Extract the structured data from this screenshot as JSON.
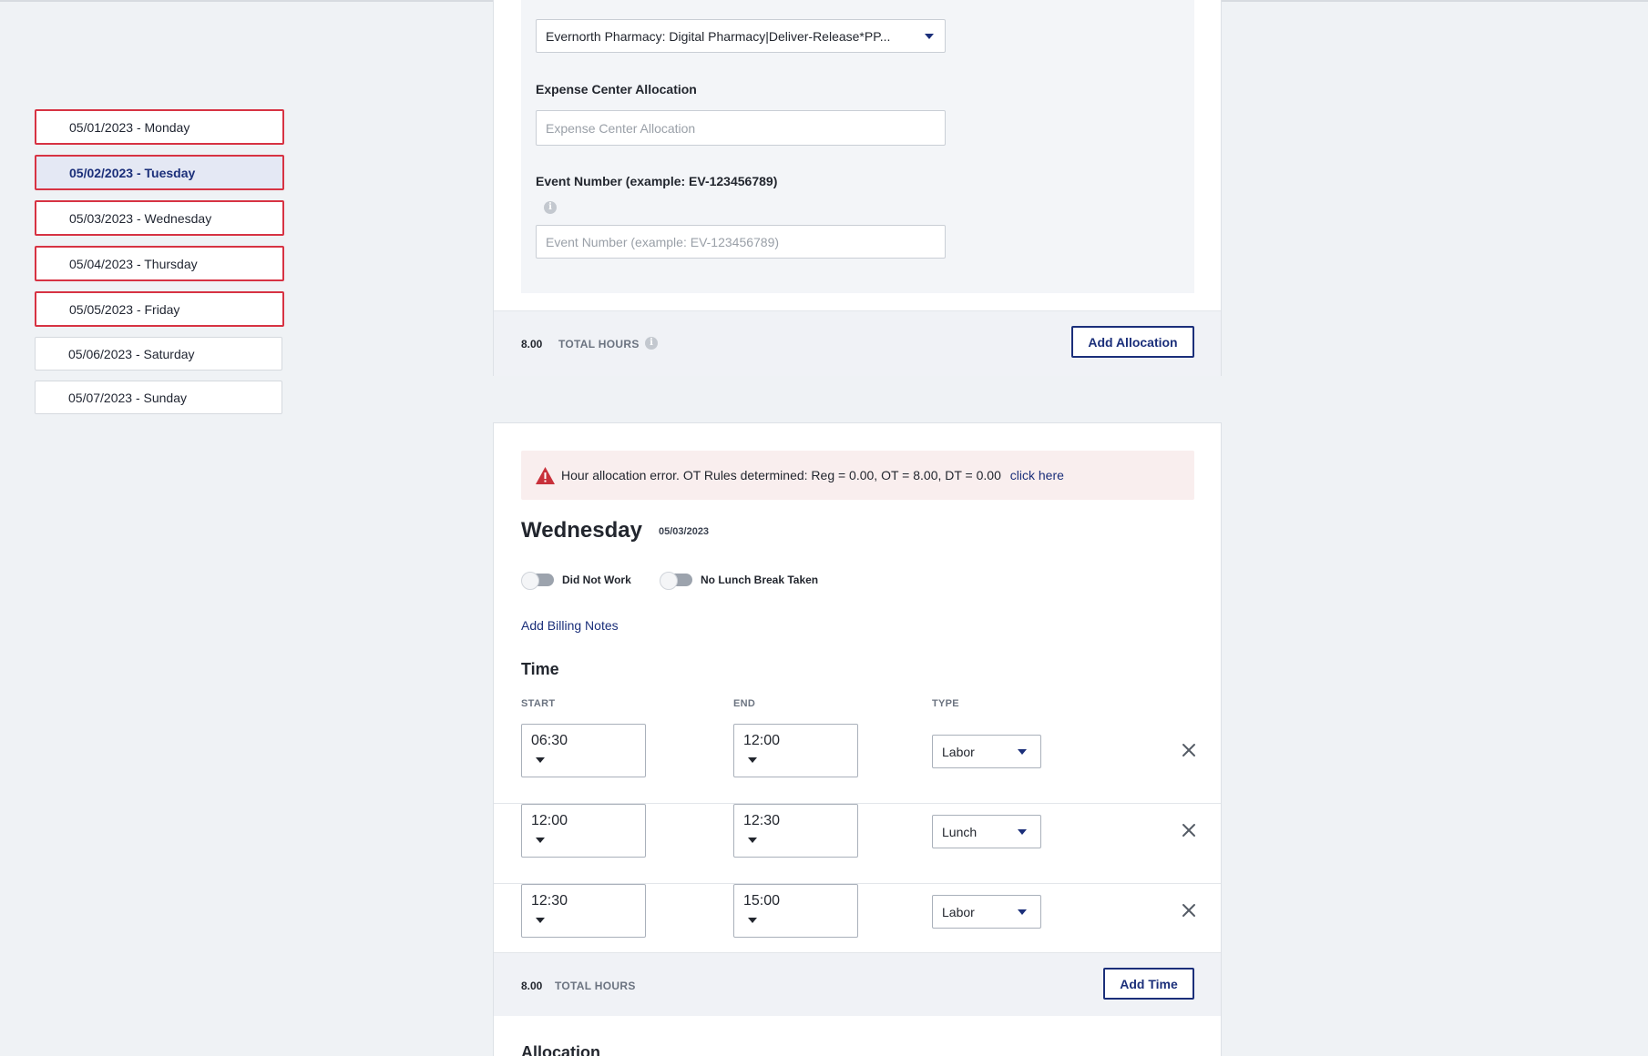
{
  "days": [
    {
      "label": "05/01/2023 - Monday"
    },
    {
      "label": "05/02/2023 - Tuesday"
    },
    {
      "label": "05/03/2023 - Wednesday"
    },
    {
      "label": "05/04/2023 - Thursday"
    },
    {
      "label": "05/05/2023 - Friday"
    },
    {
      "label": "05/06/2023 - Saturday"
    },
    {
      "label": "05/07/2023 - Sunday"
    }
  ],
  "allocation_panel": {
    "project_value": "Evernorth Pharmacy: Digital Pharmacy|Deliver-Release*PP...",
    "expense_label": "Expense Center Allocation",
    "expense_placeholder": "Expense Center Allocation",
    "event_label": "Event Number (example: EV-123456789)",
    "event_placeholder": "Event Number (example: EV-123456789)",
    "total_hours": "8.00",
    "total_hours_label": "TOTAL HOURS",
    "add_allocation_label": "Add Allocation"
  },
  "wednesday_panel": {
    "alert_text": "Hour allocation error. OT Rules determined: Reg = 0.00, OT = 8.00, DT = 0.00",
    "alert_link": "click here",
    "day_title": "Wednesday",
    "day_date": "05/03/2023",
    "toggle_did_not_work": "Did Not Work",
    "toggle_no_lunch": "No Lunch Break Taken",
    "add_billing_notes": "Add Billing Notes",
    "time_title": "Time",
    "col_start": "START",
    "col_end": "END",
    "col_type": "TYPE",
    "rows": [
      {
        "start": "06:30",
        "end": "12:00",
        "type": "Labor"
      },
      {
        "start": "12:00",
        "end": "12:30",
        "type": "Lunch"
      },
      {
        "start": "12:30",
        "end": "15:00",
        "type": "Labor"
      }
    ],
    "total_hours": "8.00",
    "total_hours_label": "TOTAL HOURS",
    "add_time_label": "Add Time",
    "allocation_title": "Allocation"
  },
  "colors": {
    "accent": "#1b2f7a",
    "error_border": "#d73343",
    "alert_bg": "#f9eeee",
    "alert_icon": "#c8303a"
  },
  "icons": [
    "info-icon",
    "warning-icon",
    "close-icon",
    "chevron-down-icon"
  ]
}
